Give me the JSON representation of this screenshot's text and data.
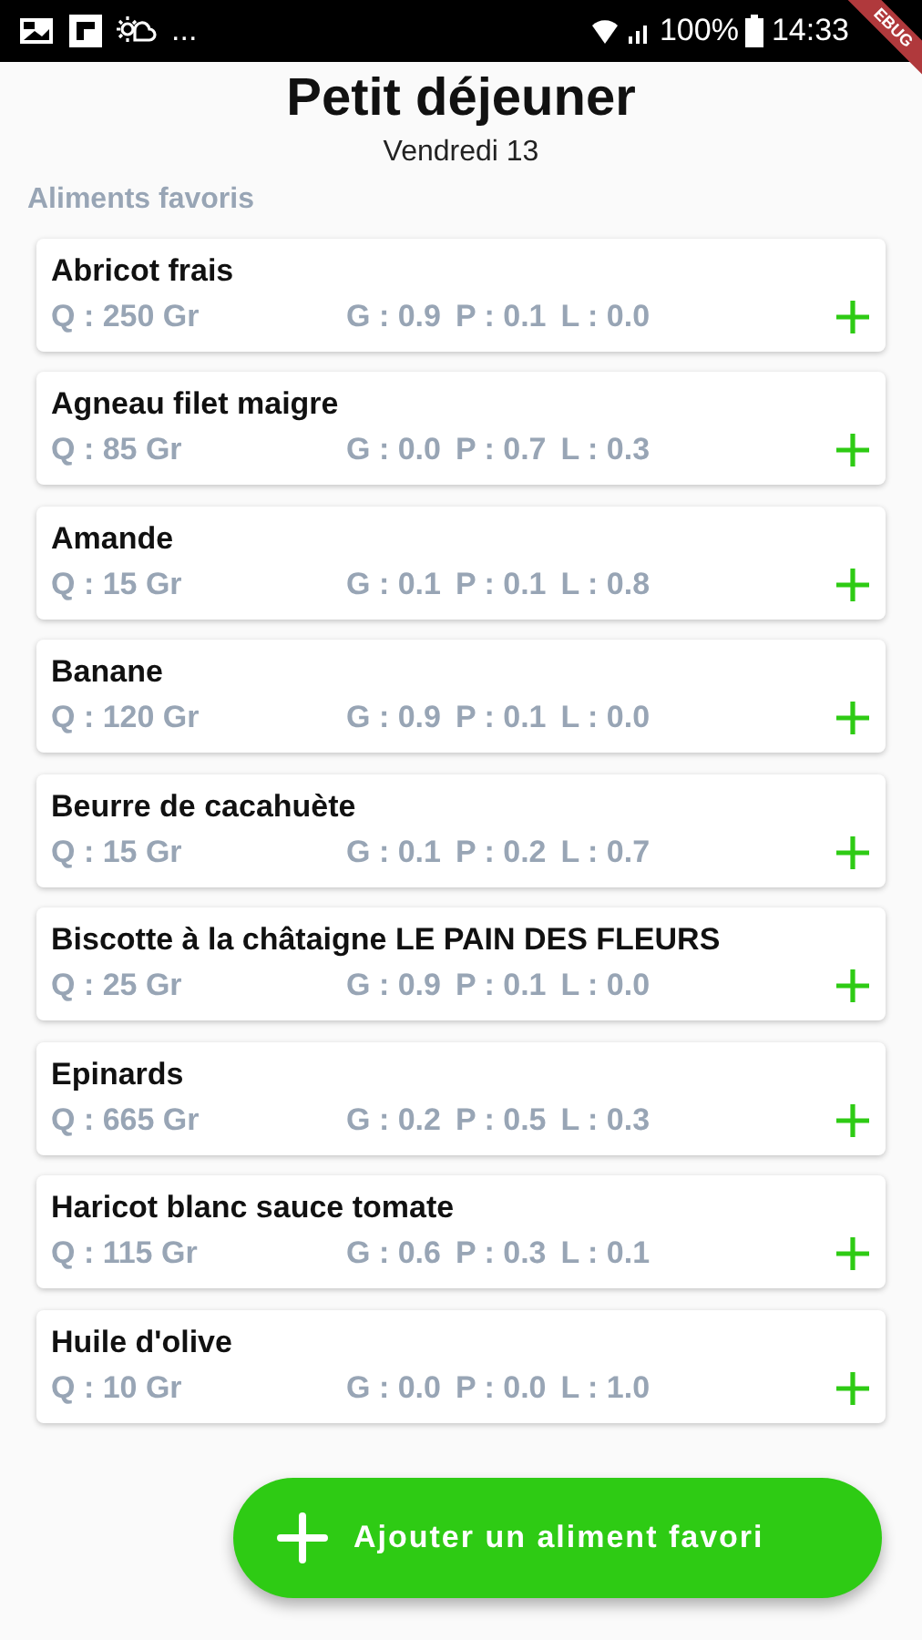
{
  "status_bar": {
    "notifications": "...",
    "battery": "100%",
    "time": "14:33"
  },
  "debug_banner": "EBUG",
  "header": {
    "title": "Petit déjeuner",
    "subtitle": "Vendredi 13"
  },
  "section_title": "Aliments favoris",
  "foods": [
    {
      "name": "Abricot frais",
      "quantity": "Q : 250 Gr",
      "g": "G : 0.9",
      "p": "P : 0.1",
      "l": "L : 0.0"
    },
    {
      "name": "Agneau filet maigre",
      "quantity": "Q : 85 Gr",
      "g": "G : 0.0",
      "p": "P : 0.7",
      "l": "L : 0.3"
    },
    {
      "name": "Amande",
      "quantity": "Q : 15 Gr",
      "g": "G : 0.1",
      "p": "P : 0.1",
      "l": "L : 0.8"
    },
    {
      "name": "Banane",
      "quantity": "Q : 120 Gr",
      "g": "G : 0.9",
      "p": "P : 0.1",
      "l": "L : 0.0"
    },
    {
      "name": "Beurre de cacahuète",
      "quantity": "Q : 15 Gr",
      "g": "G : 0.1",
      "p": "P : 0.2",
      "l": "L : 0.7"
    },
    {
      "name": "Biscotte à la châtaigne LE PAIN DES FLEURS",
      "quantity": "Q : 25 Gr",
      "g": "G : 0.9",
      "p": "P : 0.1",
      "l": "L : 0.0"
    },
    {
      "name": "Epinards",
      "quantity": "Q : 665 Gr",
      "g": "G : 0.2",
      "p": "P : 0.5",
      "l": "L : 0.3"
    },
    {
      "name": "Haricot blanc sauce tomate",
      "quantity": "Q : 115 Gr",
      "g": "G : 0.6",
      "p": "P : 0.3",
      "l": "L : 0.1"
    },
    {
      "name": "Huile d'olive",
      "quantity": "Q : 10 Gr",
      "g": "G : 0.0",
      "p": "P : 0.0",
      "l": "L : 1.0"
    }
  ],
  "add_button": "Ajouter un aliment favori"
}
